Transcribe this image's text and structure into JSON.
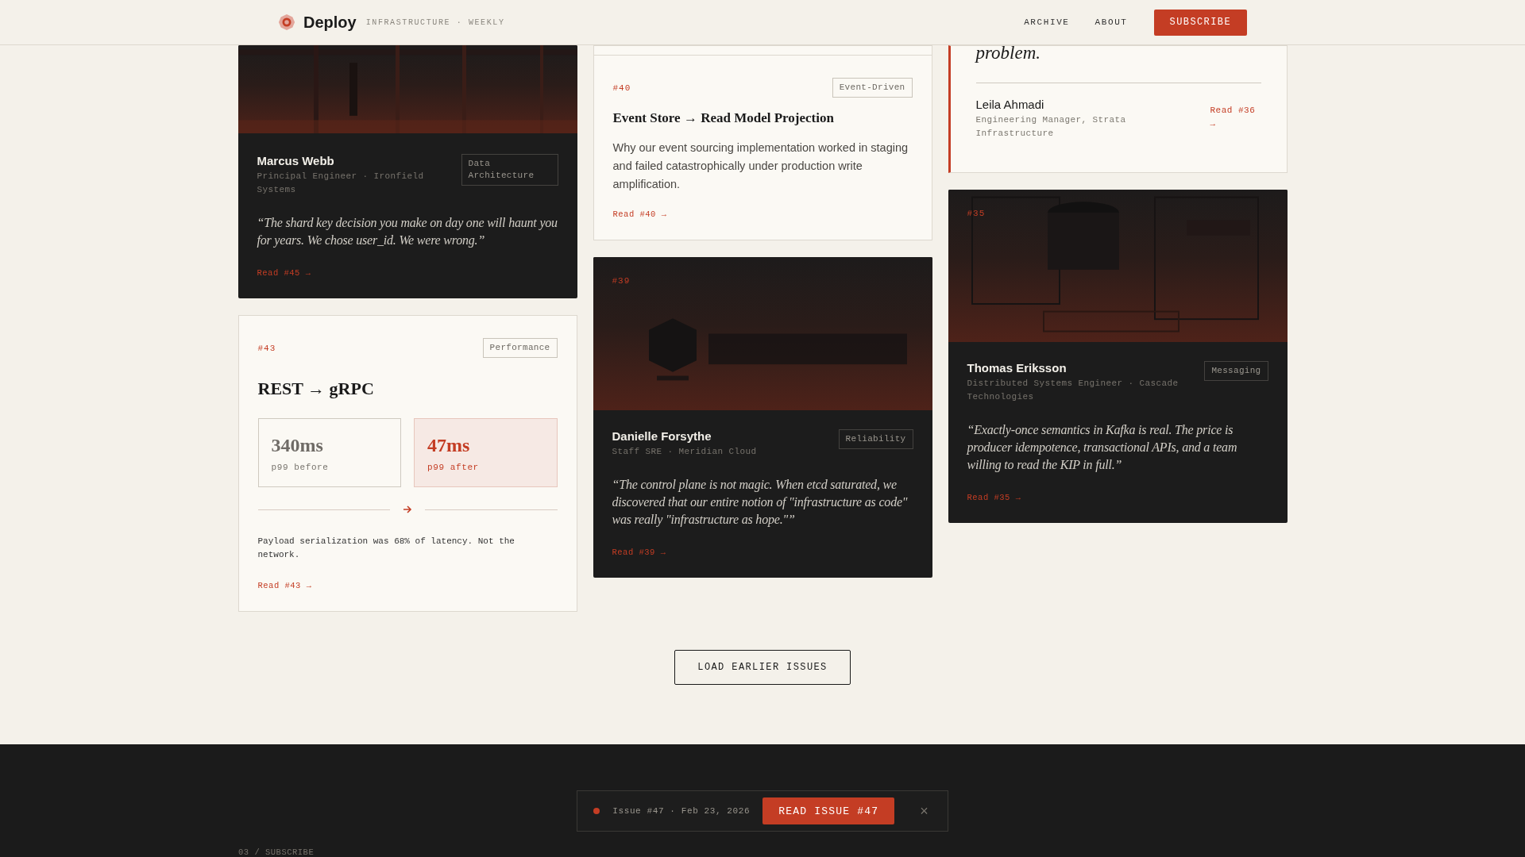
{
  "header": {
    "logo": "Deploy",
    "tagline": "INFRASTRUCTURE · WEEKLY",
    "nav": [
      {
        "label": "ARCHIVE"
      },
      {
        "label": "ABOUT"
      }
    ],
    "subscribe": "SUBSCRIBE"
  },
  "columns": [
    [
      {
        "kind": "portrait",
        "author": "Marcus Webb",
        "role": "Principal Engineer · Ironfield Systems",
        "tag": "Data Architecture",
        "quote": "“The shard key decision you make on day one will haunt you for years. We chose user_id. We were wrong.”",
        "link": "Read #45 →"
      },
      {
        "kind": "metric",
        "number": "#43",
        "tag": "Performance",
        "title": "REST → gRPC",
        "metrics": [
          {
            "value": "340ms",
            "label": "p99 before",
            "highlight": false
          },
          {
            "value": "47ms",
            "label": "p99 after",
            "highlight": true
          }
        ],
        "note": "Payload serialization was 68% of latency. Not the network.",
        "link": "Read #43 →"
      }
    ],
    [
      {
        "kind": "article",
        "number": "#40",
        "tag": "Event-Driven",
        "title": "Event Store → Read Model Projection",
        "summary": "Why our event sourcing implementation worked in staging and failed catastrophically under production write amplification.",
        "link": "Read #40 →"
      },
      {
        "kind": "portrait",
        "number": "#39",
        "author": "Danielle Forsythe",
        "role": "Staff SRE · Meridian Cloud",
        "tag": "Reliability",
        "quote": "“The control plane is not magic. When etcd saturated, we discovered that our entire notion of \"infrastructure as code\" was really \"infrastructure as hope.\"”",
        "link": "Read #39 →"
      }
    ],
    [
      {
        "kind": "quote",
        "quote": "problem.",
        "author": "Leila Ahmadi",
        "role": "Engineering Manager, Strata Infrastructure",
        "link": "Read #36 →"
      },
      {
        "kind": "portrait",
        "number": "#35",
        "author": "Thomas Eriksson",
        "role": "Distributed Systems Engineer · Cascade Technologies",
        "tag": "Messaging",
        "quote": "“Exactly-once semantics in Kafka is real. The price is producer idempotence, transactional APIs, and a team willing to read the KIP in full.”",
        "link": "Read #35 →"
      }
    ]
  ],
  "load_more": "LOAD EARLIER ISSUES",
  "banner": {
    "issue": "Issue #47 · Feb 23, 2026",
    "button": "READ ISSUE #47",
    "close": "×"
  },
  "footer": {
    "section": "03 / SUBSCRIBE"
  }
}
